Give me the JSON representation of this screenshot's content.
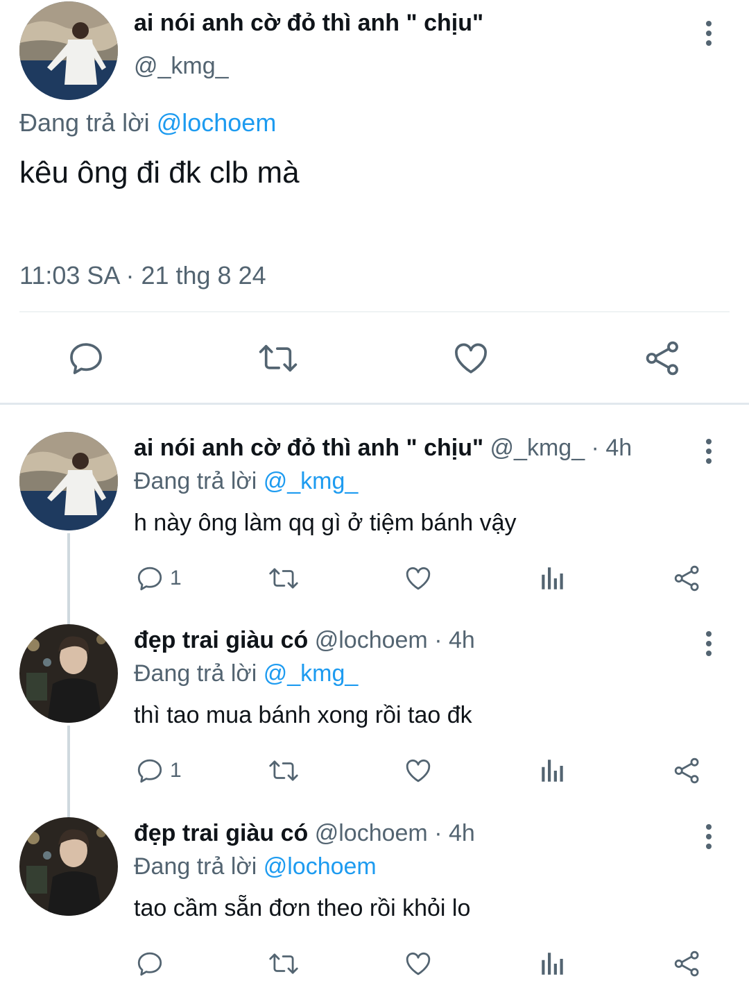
{
  "colors": {
    "accent": "#1d9bf0",
    "secondary_text": "#536471",
    "icon": "#536471"
  },
  "main_tweet": {
    "display_name": "ai nói anh cờ đỏ thì anh \" chịu\"",
    "handle": "@_kmg_",
    "replying_label": "Đang trả lời",
    "replying_to": "@lochoem",
    "text": "kêu ông đi đk clb mà",
    "timestamp": "11:03 SA · 21 thg 8 24",
    "actions": [
      "reply-icon",
      "retweet-icon",
      "like-icon",
      "share-icon"
    ]
  },
  "replies": [
    {
      "display_name": "ai nói anh cờ đỏ thì anh \" chịu\"",
      "meta": "@_kmg_ · 4h",
      "replying_label": "Đang trả lời",
      "replying_to": "@_kmg_",
      "text": "h này ông làm qq gì ở tiệm bánh vậy",
      "reply_count": "1"
    },
    {
      "display_name": "đẹp trai giàu có",
      "meta": "@lochoem · 4h",
      "replying_label": "Đang trả lời",
      "replying_to": "@_kmg_",
      "text": "thì tao mua bánh xong rồi tao đk",
      "reply_count": "1"
    },
    {
      "display_name": "đẹp trai giàu có",
      "meta": "@lochoem · 4h",
      "replying_label": "Đang trả lời",
      "replying_to": "@lochoem",
      "text": "tao cầm sẵn đơn theo rồi khỏi lo",
      "reply_count": ""
    }
  ]
}
